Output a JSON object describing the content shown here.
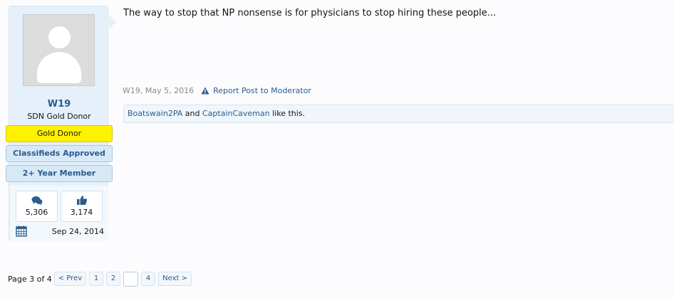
{
  "user": {
    "name": "W19",
    "title": "SDN Gold Donor",
    "banners": [
      "Gold Donor",
      "Classifieds Approved",
      "2+ Year Member"
    ],
    "messages_count": "5,306",
    "likes_count": "3,174",
    "join_date": "Sep 24, 2014"
  },
  "post": {
    "text": "The way to stop that NP nonsense is for physicians to stop hiring these people...",
    "meta": "W19, May 5, 2016",
    "report_label": "Report Post to Moderator",
    "likes": {
      "user1": "Boatswain2PA",
      "and": "and",
      "user2": "CaptainCaveman",
      "suffix": "like this."
    }
  },
  "pagination": {
    "info": "Page 3 of 4",
    "prev": "< Prev",
    "pages": [
      "1",
      "2",
      "",
      "4"
    ],
    "next": "Next >"
  },
  "colors": {
    "link": "#2b5c8e",
    "gold_banner": "#fff200",
    "sidebar_bg": "#e6f0fa"
  }
}
